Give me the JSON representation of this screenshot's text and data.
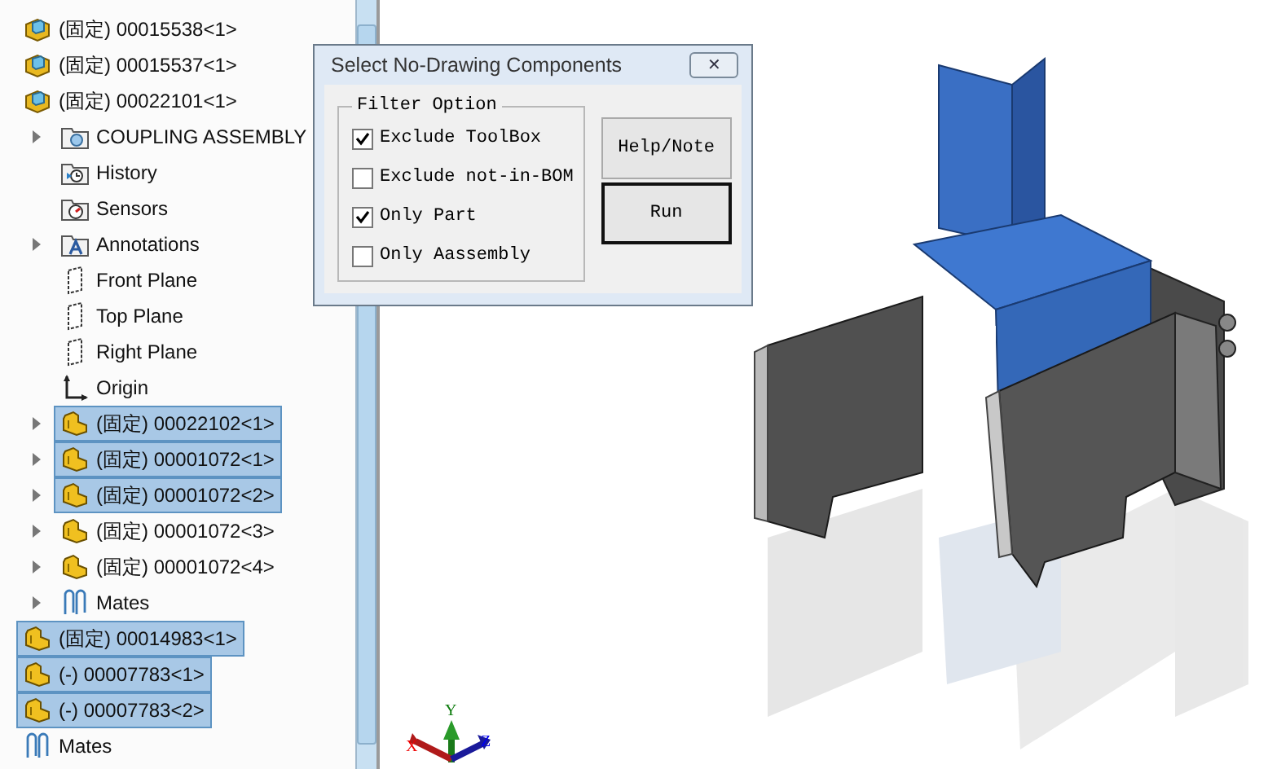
{
  "tree": [
    {
      "kind": "part",
      "label": "(固定) 00015538<1>",
      "selected": false,
      "expandable": false
    },
    {
      "kind": "part",
      "label": "(固定) 00015537<1>",
      "selected": false,
      "expandable": false
    },
    {
      "kind": "part",
      "label": "(固定) 00022101<1>",
      "selected": false,
      "expandable": false,
      "children": [
        {
          "kind": "folder",
          "label": "COUPLING ASSEMBLY",
          "selected": false,
          "expandable": true
        },
        {
          "kind": "history",
          "label": "History",
          "selected": false,
          "expandable": false
        },
        {
          "kind": "sensors",
          "label": "Sensors",
          "selected": false,
          "expandable": false
        },
        {
          "kind": "annotations",
          "label": "Annotations",
          "selected": false,
          "expandable": true
        },
        {
          "kind": "plane",
          "label": "Front Plane",
          "selected": false,
          "expandable": false
        },
        {
          "kind": "plane",
          "label": "Top Plane",
          "selected": false,
          "expandable": false
        },
        {
          "kind": "plane",
          "label": "Right Plane",
          "selected": false,
          "expandable": false
        },
        {
          "kind": "origin",
          "label": "Origin",
          "selected": false,
          "expandable": false
        },
        {
          "kind": "assembly",
          "label": "(固定) 00022102<1>",
          "selected": true,
          "expandable": true
        },
        {
          "kind": "assembly",
          "label": "(固定) 00001072<1>",
          "selected": true,
          "expandable": true
        },
        {
          "kind": "assembly",
          "label": "(固定) 00001072<2>",
          "selected": true,
          "expandable": true
        },
        {
          "kind": "assembly",
          "label": "(固定) 00001072<3>",
          "selected": false,
          "expandable": true
        },
        {
          "kind": "assembly",
          "label": "(固定) 00001072<4>",
          "selected": false,
          "expandable": true
        },
        {
          "kind": "mates",
          "label": "Mates",
          "selected": false,
          "expandable": true
        }
      ]
    },
    {
      "kind": "assembly",
      "label": "(固定) 00014983<1>",
      "selected": true,
      "expandable": false
    },
    {
      "kind": "assembly",
      "label": "(-) 00007783<1>",
      "selected": true,
      "expandable": false
    },
    {
      "kind": "assembly",
      "label": "(-) 00007783<2>",
      "selected": true,
      "expandable": false
    },
    {
      "kind": "mates",
      "label": "Mates",
      "selected": false,
      "expandable": false
    }
  ],
  "dialog": {
    "title": "Select No-Drawing Components",
    "close": "✕",
    "group_title": "Filter Option",
    "options": [
      {
        "label": "Exclude ToolBox",
        "checked": true
      },
      {
        "label": "Exclude not-in-BOM",
        "checked": false
      },
      {
        "label": "Only Part",
        "checked": true
      },
      {
        "label": "Only Aassembly",
        "checked": false
      }
    ],
    "buttons": [
      {
        "label": "Help/Note",
        "default": false
      },
      {
        "label": "Run",
        "default": true
      }
    ]
  },
  "triad": {
    "labels": [
      "X",
      "Y",
      "Z"
    ]
  }
}
